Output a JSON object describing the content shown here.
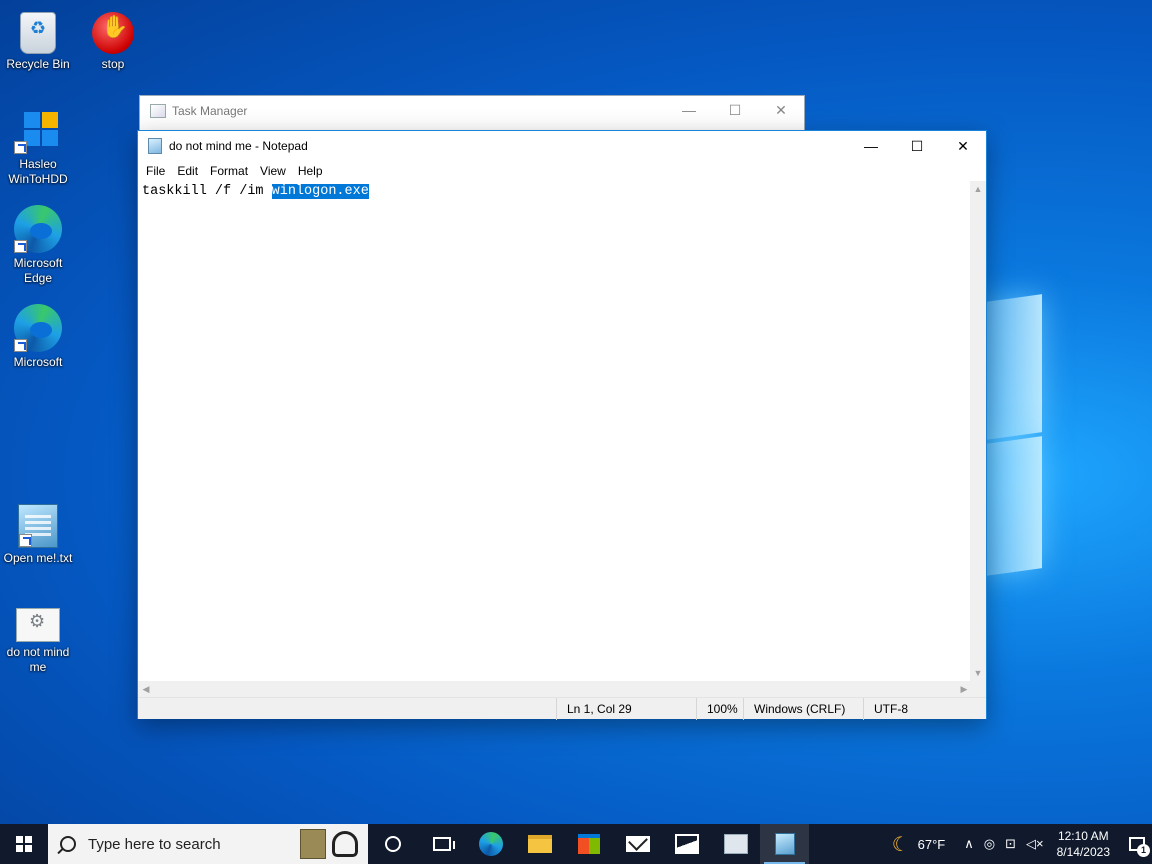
{
  "desktop": {
    "icons": [
      {
        "label": "Recycle Bin",
        "icon": "recycle-bin-icon"
      },
      {
        "label": "stop",
        "icon": "stop-hand-icon"
      },
      {
        "label": "Hasleo WinToHDD",
        "icon": "hasleo-wintohdd-icon"
      },
      {
        "label": "Microsoft Edge",
        "icon": "edge-icon"
      },
      {
        "label": "Microsoft",
        "icon": "edge-icon"
      },
      {
        "label": "Open me!.txt",
        "icon": "notepad-file-icon"
      },
      {
        "label": "do not mind me",
        "icon": "settings-file-icon"
      }
    ]
  },
  "task_manager": {
    "title": "Task Manager",
    "min": "—",
    "max": "☐",
    "close": "✕"
  },
  "notepad": {
    "title": "do not mind me - Notepad",
    "min": "—",
    "max": "☐",
    "close": "✕",
    "menu": [
      "File",
      "Edit",
      "Format",
      "View",
      "Help"
    ],
    "text_before": "taskkill /f /im ",
    "text_selected": "winlogon.exe",
    "status": {
      "position": "Ln 1, Col 29",
      "zoom": "100%",
      "line_ending": "Windows (CRLF)",
      "encoding": "UTF-8"
    }
  },
  "taskbar": {
    "search_placeholder": "Type here to search",
    "apps": [
      "cortana-icon",
      "task-view-icon",
      "edge-icon",
      "file-explorer-icon",
      "store-icon",
      "mail-icon",
      "photos-icon",
      "task-manager-icon",
      "notepad-icon"
    ],
    "temperature": "67°F",
    "time": "12:10 AM",
    "date": "8/14/2023",
    "notification_count": "1"
  }
}
